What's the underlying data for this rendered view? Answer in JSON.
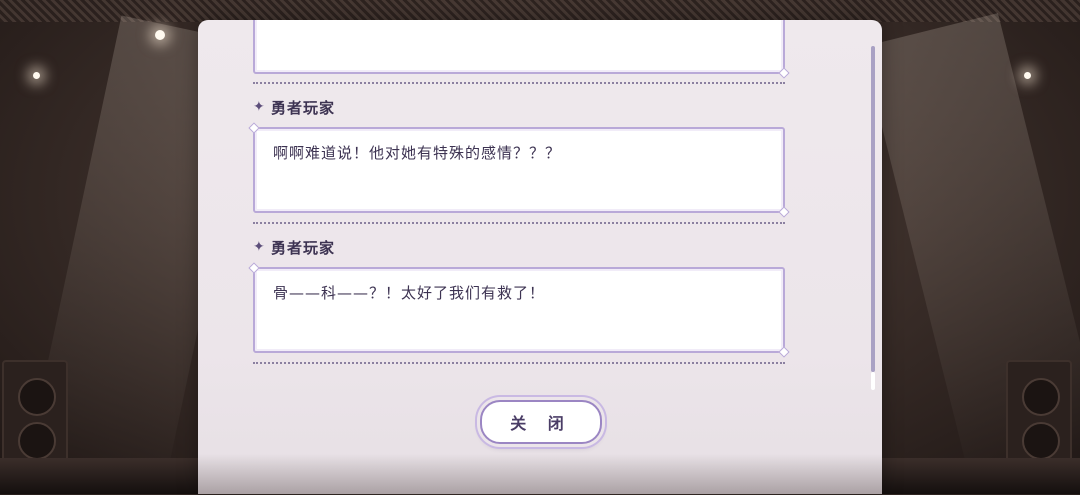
{
  "dialog_log": {
    "entries": [
      {
        "speaker": "",
        "text": ""
      },
      {
        "speaker": "勇者玩家",
        "text": "啊啊难道说！他对她有特殊的感情？？？"
      },
      {
        "speaker": "勇者玩家",
        "text": "骨——科——？！太好了我们有救了！"
      }
    ],
    "close_label": "关 闭"
  },
  "icons": {
    "speaker_marker": "sparkle-star-icon"
  },
  "colors": {
    "accent": "#9b86c3",
    "bubble_border": "#b9a9d8",
    "text": "#3d3352"
  }
}
